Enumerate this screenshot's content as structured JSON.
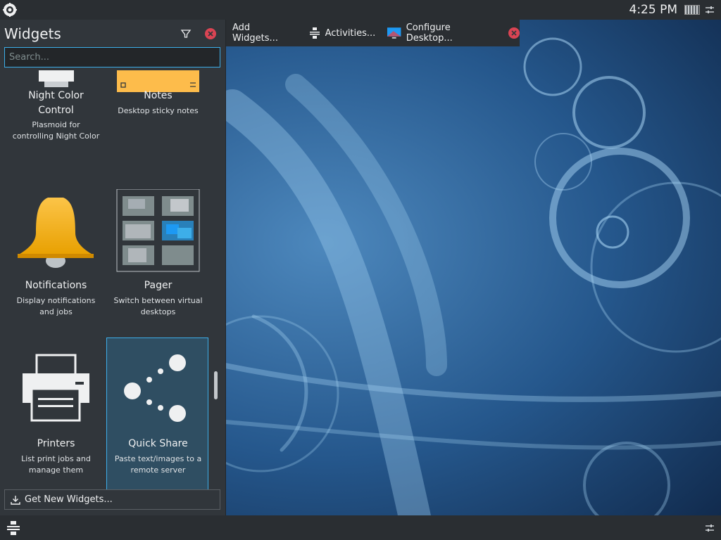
{
  "top_panel": {
    "clock": "4:25 PM",
    "icons": {
      "launcher": "kde-launcher-icon",
      "pager": "pager-mini-icon",
      "config": "panel-config-icon"
    }
  },
  "toolbox": {
    "add_widgets": "Add Widgets...",
    "activities": "Activities...",
    "configure_desktop": "Configure Desktop..."
  },
  "widgets_panel": {
    "title": "Widgets",
    "search_placeholder": "Search...",
    "get_new": "Get New Widgets...",
    "widgets": [
      {
        "name": "Night Color\nControl",
        "desc": "Plasmoid for controlling Night Color",
        "icon": "monitor-icon"
      },
      {
        "name": "Notes",
        "desc": "Desktop sticky notes",
        "icon": "note-icon"
      },
      {
        "name": "Notifications",
        "desc": "Display notifications and jobs",
        "icon": "bell-icon"
      },
      {
        "name": "Pager",
        "desc": "Switch between virtual desktops",
        "icon": "pager-icon"
      },
      {
        "name": "Printers",
        "desc": "List print jobs and manage them",
        "icon": "printer-icon"
      },
      {
        "name": "Quick Share",
        "desc": "Paste text/images to a remote server",
        "icon": "share-icon",
        "selected": true
      }
    ]
  },
  "colors": {
    "accent": "#3daee9",
    "panel_bg": "#31363b",
    "close_red": "#da4453",
    "note_yellow": "#fdbc4b",
    "bell_gold": "#f6a800"
  }
}
